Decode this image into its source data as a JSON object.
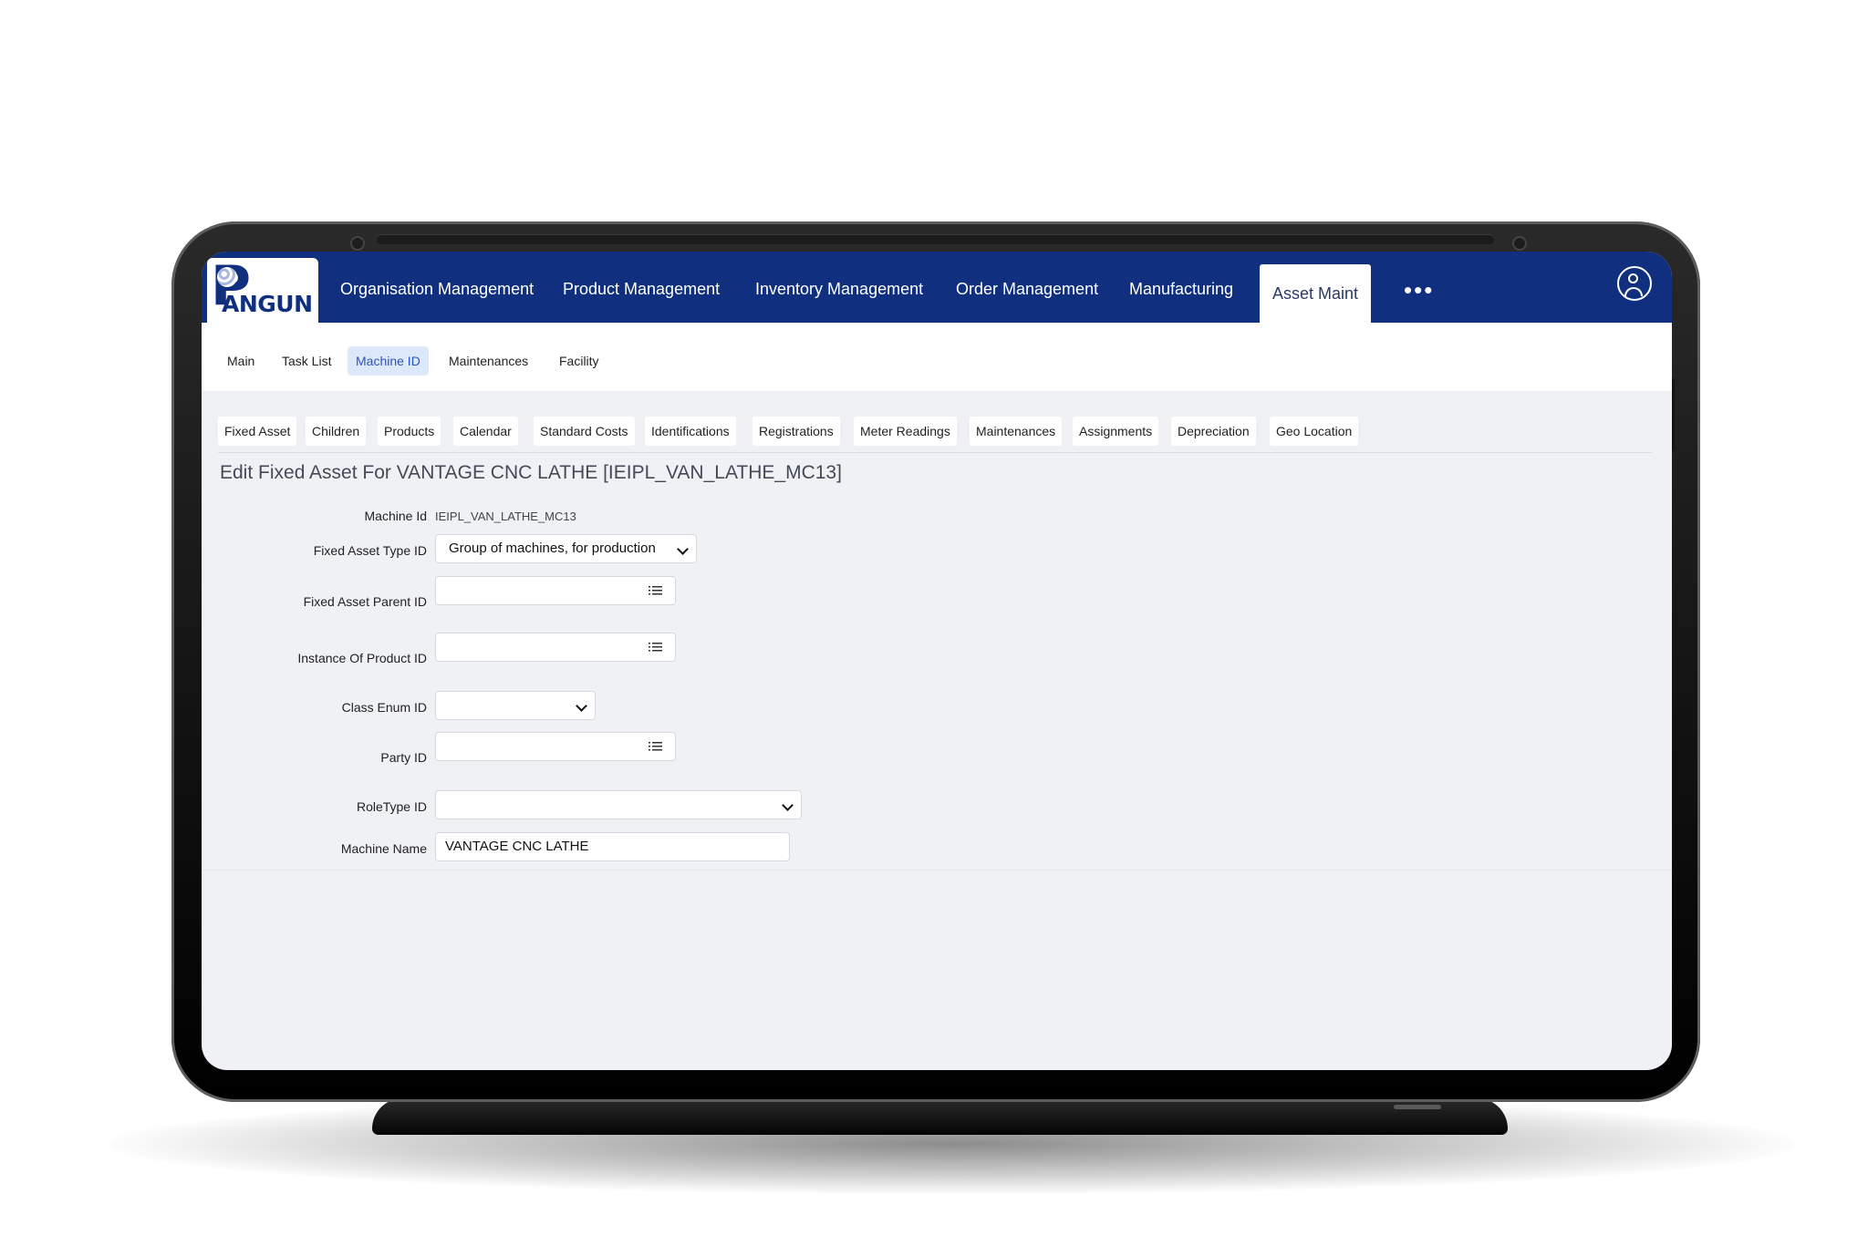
{
  "app": {
    "logo_text": "ANGUN",
    "logo_letter": "P",
    "top_nav": [
      {
        "label": "Organisation Management"
      },
      {
        "label": "Product Management"
      },
      {
        "label": "Inventory Management"
      },
      {
        "label": "Order Management"
      },
      {
        "label": "Manufacturing"
      },
      {
        "label": "Asset Maint",
        "active": true
      }
    ],
    "more_icon": "•••",
    "user_icon": "user-circle-icon",
    "accent_color": "#10307f"
  },
  "subnav": [
    {
      "label": "Main"
    },
    {
      "label": "Task List"
    },
    {
      "label": "Machine ID",
      "active": true
    },
    {
      "label": "Maintenances"
    },
    {
      "label": "Facility"
    }
  ],
  "tabs": [
    {
      "label": "Fixed Asset"
    },
    {
      "label": "Children"
    },
    {
      "label": "Products"
    },
    {
      "label": "Calendar"
    },
    {
      "label": "Standard Costs"
    },
    {
      "label": "Identifications"
    },
    {
      "label": "Registrations"
    },
    {
      "label": "Meter Readings"
    },
    {
      "label": "Maintenances"
    },
    {
      "label": "Assignments"
    },
    {
      "label": "Depreciation"
    },
    {
      "label": "Geo Location"
    }
  ],
  "form": {
    "title": "Edit Fixed Asset For VANTAGE CNC LATHE [IEIPL_VAN_LATHE_MC13]",
    "fields": {
      "machine_id": {
        "label": "Machine Id",
        "value": "IEIPL_VAN_LATHE_MC13"
      },
      "fixed_asset_type_id": {
        "label": "Fixed Asset Type ID",
        "value": "Group of machines, for production"
      },
      "fixed_asset_parent_id": {
        "label": "Fixed Asset Parent ID",
        "value": ""
      },
      "instance_of_product_id": {
        "label": "Instance Of Product ID",
        "value": ""
      },
      "class_enum_id": {
        "label": "Class Enum ID",
        "value": ""
      },
      "party_id": {
        "label": "Party ID",
        "value": ""
      },
      "role_type_id": {
        "label": "RoleType ID",
        "value": ""
      },
      "machine_name": {
        "label": "Machine Name",
        "value": "VANTAGE CNC LATHE"
      }
    }
  }
}
